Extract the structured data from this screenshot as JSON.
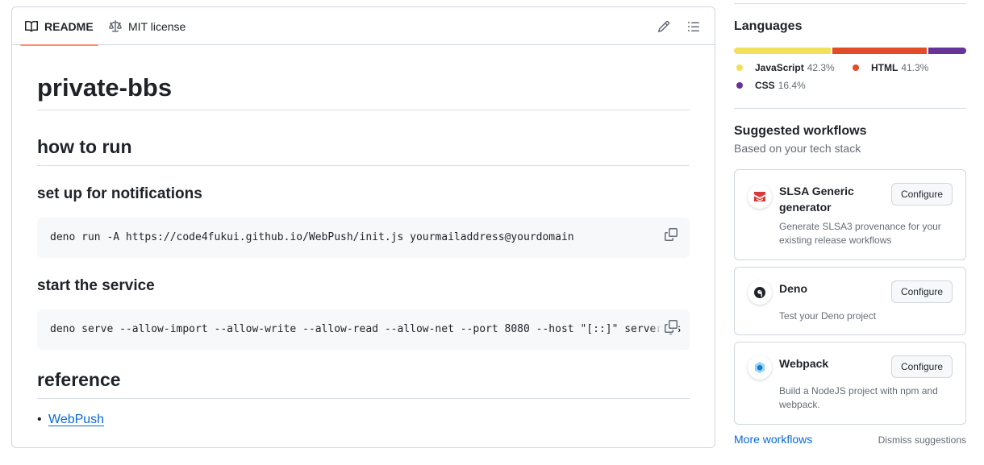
{
  "readme": {
    "tabs": [
      {
        "label": "README",
        "icon": "book-icon",
        "active": true
      },
      {
        "label": "MIT license",
        "icon": "law-scale-icon",
        "active": false
      }
    ],
    "title": "private-bbs",
    "sections": {
      "how_to_run": "how to run",
      "notifications": "set up for notifications",
      "notifications_code": "deno run -A https://code4fukui.github.io/WebPush/init.js yourmailaddress@yourdomain",
      "start_service": "start the service",
      "start_service_code": "deno serve --allow-import --allow-write --allow-read --allow-net --port 8080 --host \"[::]\" server.js",
      "reference": "reference"
    },
    "links": [
      "WebPush"
    ]
  },
  "sidebar": {
    "languages": {
      "heading": "Languages",
      "items": [
        {
          "name": "JavaScript",
          "pct": "42.3%",
          "color": "#f1e05a",
          "value": 42.3
        },
        {
          "name": "HTML",
          "pct": "41.3%",
          "color": "#e34c26",
          "value": 41.3
        },
        {
          "name": "CSS",
          "pct": "16.4%",
          "color": "#663399",
          "value": 16.4
        }
      ]
    },
    "workflows": {
      "heading": "Suggested workflows",
      "subheading": "Based on your tech stack",
      "cards": [
        {
          "title": "SLSA Generic generator",
          "desc": "Generate SLSA3 provenance for your existing release workflows",
          "button": "Configure",
          "icon": "slsa-icon"
        },
        {
          "title": "Deno",
          "desc": "Test your Deno project",
          "button": "Configure",
          "icon": "deno-icon"
        },
        {
          "title": "Webpack",
          "desc": "Build a NodeJS project with npm and webpack.",
          "button": "Configure",
          "icon": "webpack-icon"
        }
      ],
      "more": "More workflows",
      "dismiss": "Dismiss suggestions"
    }
  }
}
